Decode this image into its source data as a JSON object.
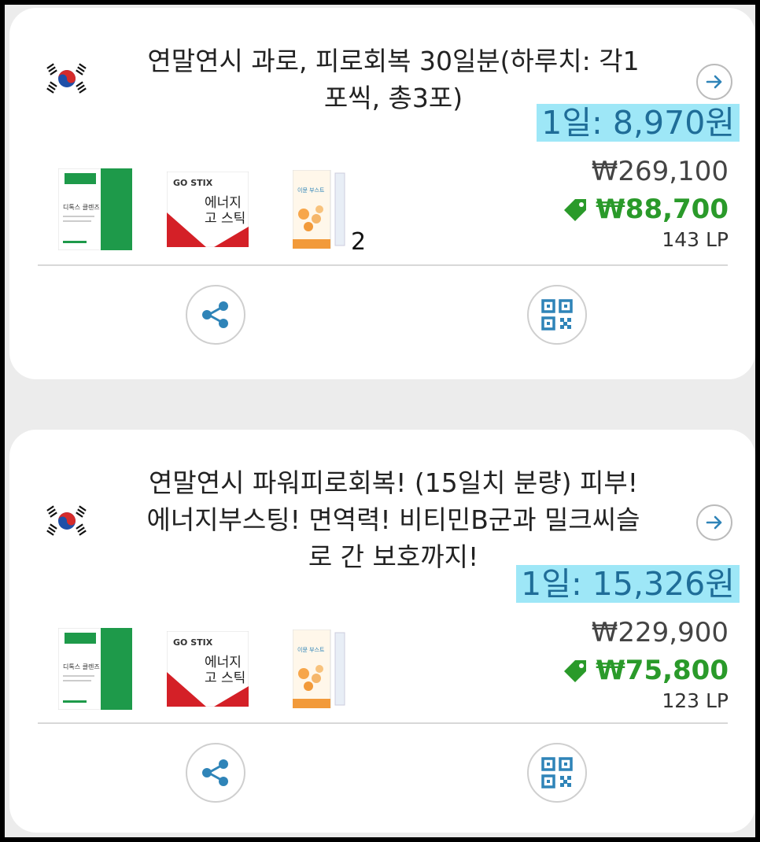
{
  "colors": {
    "accent_blue": "#2f84b8",
    "daily_highlight_bg": "#9ee7f7",
    "member_price_green": "#2a9a2a"
  },
  "cards": [
    {
      "flag_icon": "korea-flag-icon",
      "title_line1": "연말연시 과로, 피로회복 30일분(하루치: 각1",
      "title_line2": "포씩, 총3포)",
      "daily_price": "1일: 8,970원",
      "original_price": "₩269,100",
      "member_price": "₩88,700",
      "lp": "143 LP",
      "product_count_badge": "2",
      "products": [
        "green-product-box",
        "gostix-energy-box",
        "orange-stick-pouch"
      ]
    },
    {
      "flag_icon": "korea-flag-icon",
      "title_line1": "연말연시 파워피로회복! (15일치 분량) 피부!",
      "title_line2": "에너지부스팅! 면역력! 비티민B군과 밀크씨슬",
      "title_line3": "로 간 보호까지!",
      "daily_price": "1일: 15,326원",
      "original_price": "₩229,900",
      "member_price": "₩75,800",
      "lp": "123 LP",
      "products": [
        "green-product-box",
        "gostix-energy-box",
        "orange-stick-pouch"
      ]
    }
  ],
  "product_labels": {
    "green_box_line1": "디톡스 클렌즈",
    "gostix_brand": "GO STIX",
    "gostix_line1": "에너지",
    "gostix_line2": "고 스틱",
    "orange_pouch_label": "이뮨 부스트"
  }
}
